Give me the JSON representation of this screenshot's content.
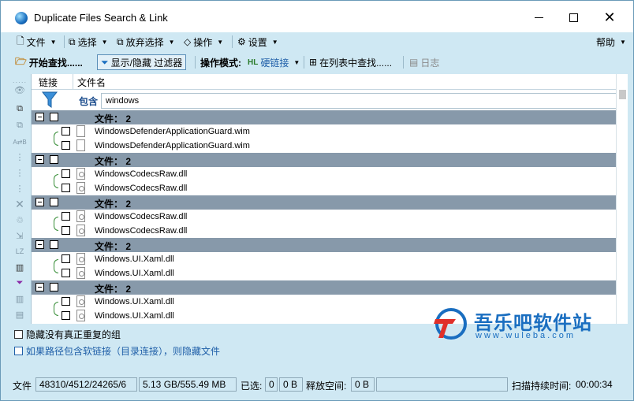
{
  "window": {
    "title": "Duplicate Files Search & Link"
  },
  "menubar": {
    "file": "文件",
    "select": "选择",
    "deselect": "放弃选择",
    "operate": "操作",
    "settings": "设置",
    "help": "帮助"
  },
  "toolbar": {
    "start_search": "开始查找......",
    "toggle_filter": "显示/隐藏 过滤器",
    "mode_label": "操作模式:",
    "mode_value": "硬链接",
    "find_in_list": "在列表中查找......",
    "log": "日志"
  },
  "grid": {
    "col_link": "链接",
    "col_filename": "文件名",
    "filter_label": "包含",
    "filter_value": "windows",
    "groups": [
      {
        "label": "文件： 2",
        "files": [
          {
            "name": "WindowsDefenderApplicationGuard.wim",
            "type": "file"
          },
          {
            "name": "WindowsDefenderApplicationGuard.wim",
            "type": "file"
          }
        ]
      },
      {
        "label": "文件： 2",
        "files": [
          {
            "name": "WindowsCodecsRaw.dll",
            "type": "dll"
          },
          {
            "name": "WindowsCodecsRaw.dll",
            "type": "dll"
          }
        ]
      },
      {
        "label": "文件： 2",
        "files": [
          {
            "name": "WindowsCodecsRaw.dll",
            "type": "dll"
          },
          {
            "name": "WindowsCodecsRaw.dll",
            "type": "dll"
          }
        ]
      },
      {
        "label": "文件： 2",
        "files": [
          {
            "name": "Windows.UI.Xaml.dll",
            "type": "dll"
          },
          {
            "name": "Windows.UI.Xaml.dll",
            "type": "dll"
          }
        ]
      },
      {
        "label": "文件： 2",
        "files": [
          {
            "name": "Windows.UI.Xaml.dll",
            "type": "dll"
          },
          {
            "name": "Windows.UI.Xaml.dll",
            "type": "dll"
          }
        ]
      }
    ]
  },
  "options": {
    "hide_not_dup": "隐藏没有真正重复的组",
    "hide_symlink": "如果路径包含软链接（目录连接），则隐藏文件"
  },
  "watermark": {
    "title": "吾乐吧软件站",
    "subtitle": "www.wuleba.com"
  },
  "status": {
    "files_label": "文件",
    "files_value": "48310/4512/24265/6",
    "size_value": "5.13 GB/555.49 MB",
    "selected_label": "已选:",
    "selected_count": "0",
    "selected_size": "0 B",
    "free_label": "释放空间:",
    "free_value": "0 B",
    "scan_time_label": "扫描持续时间:",
    "scan_time_value": "00:00:34"
  },
  "colors": {
    "chrome": "#cfe8f3",
    "group_row": "#8799aa",
    "link_bracket": "#3a8f3a",
    "accent_blue": "#1a6ec0"
  }
}
